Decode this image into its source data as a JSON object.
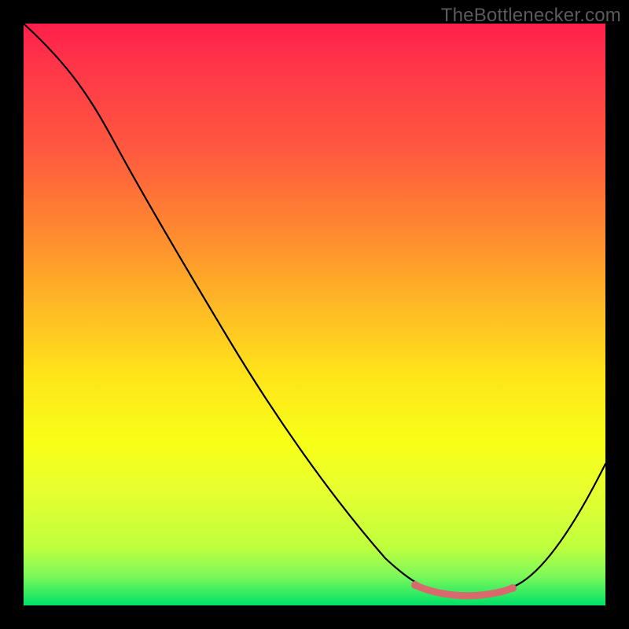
{
  "watermark": "TheBottlenecker.com",
  "chart_data": {
    "type": "line",
    "title": "",
    "xlabel": "",
    "ylabel": "",
    "xlim": [
      0,
      1
    ],
    "ylim": [
      0,
      1
    ],
    "x": [
      0.0,
      0.05,
      0.1,
      0.15,
      0.2,
      0.25,
      0.3,
      0.35,
      0.4,
      0.45,
      0.5,
      0.55,
      0.6,
      0.65,
      0.7,
      0.72,
      0.75,
      0.8,
      0.84,
      0.88,
      0.92,
      0.96,
      1.0
    ],
    "values": [
      1.0,
      0.96,
      0.91,
      0.84,
      0.76,
      0.67,
      0.59,
      0.51,
      0.43,
      0.35,
      0.28,
      0.21,
      0.15,
      0.1,
      0.06,
      0.05,
      0.04,
      0.04,
      0.05,
      0.08,
      0.13,
      0.19,
      0.26
    ],
    "highlight_range": {
      "x_start": 0.68,
      "x_end": 0.85,
      "y": 0.045
    },
    "gradient_stops": [
      {
        "pos": 0.0,
        "color": "#ff1f4b"
      },
      {
        "pos": 0.5,
        "color": "#ffd61a"
      },
      {
        "pos": 0.9,
        "color": "#bfff3e"
      },
      {
        "pos": 1.0,
        "color": "#00e268"
      }
    ],
    "background": "#000000"
  }
}
